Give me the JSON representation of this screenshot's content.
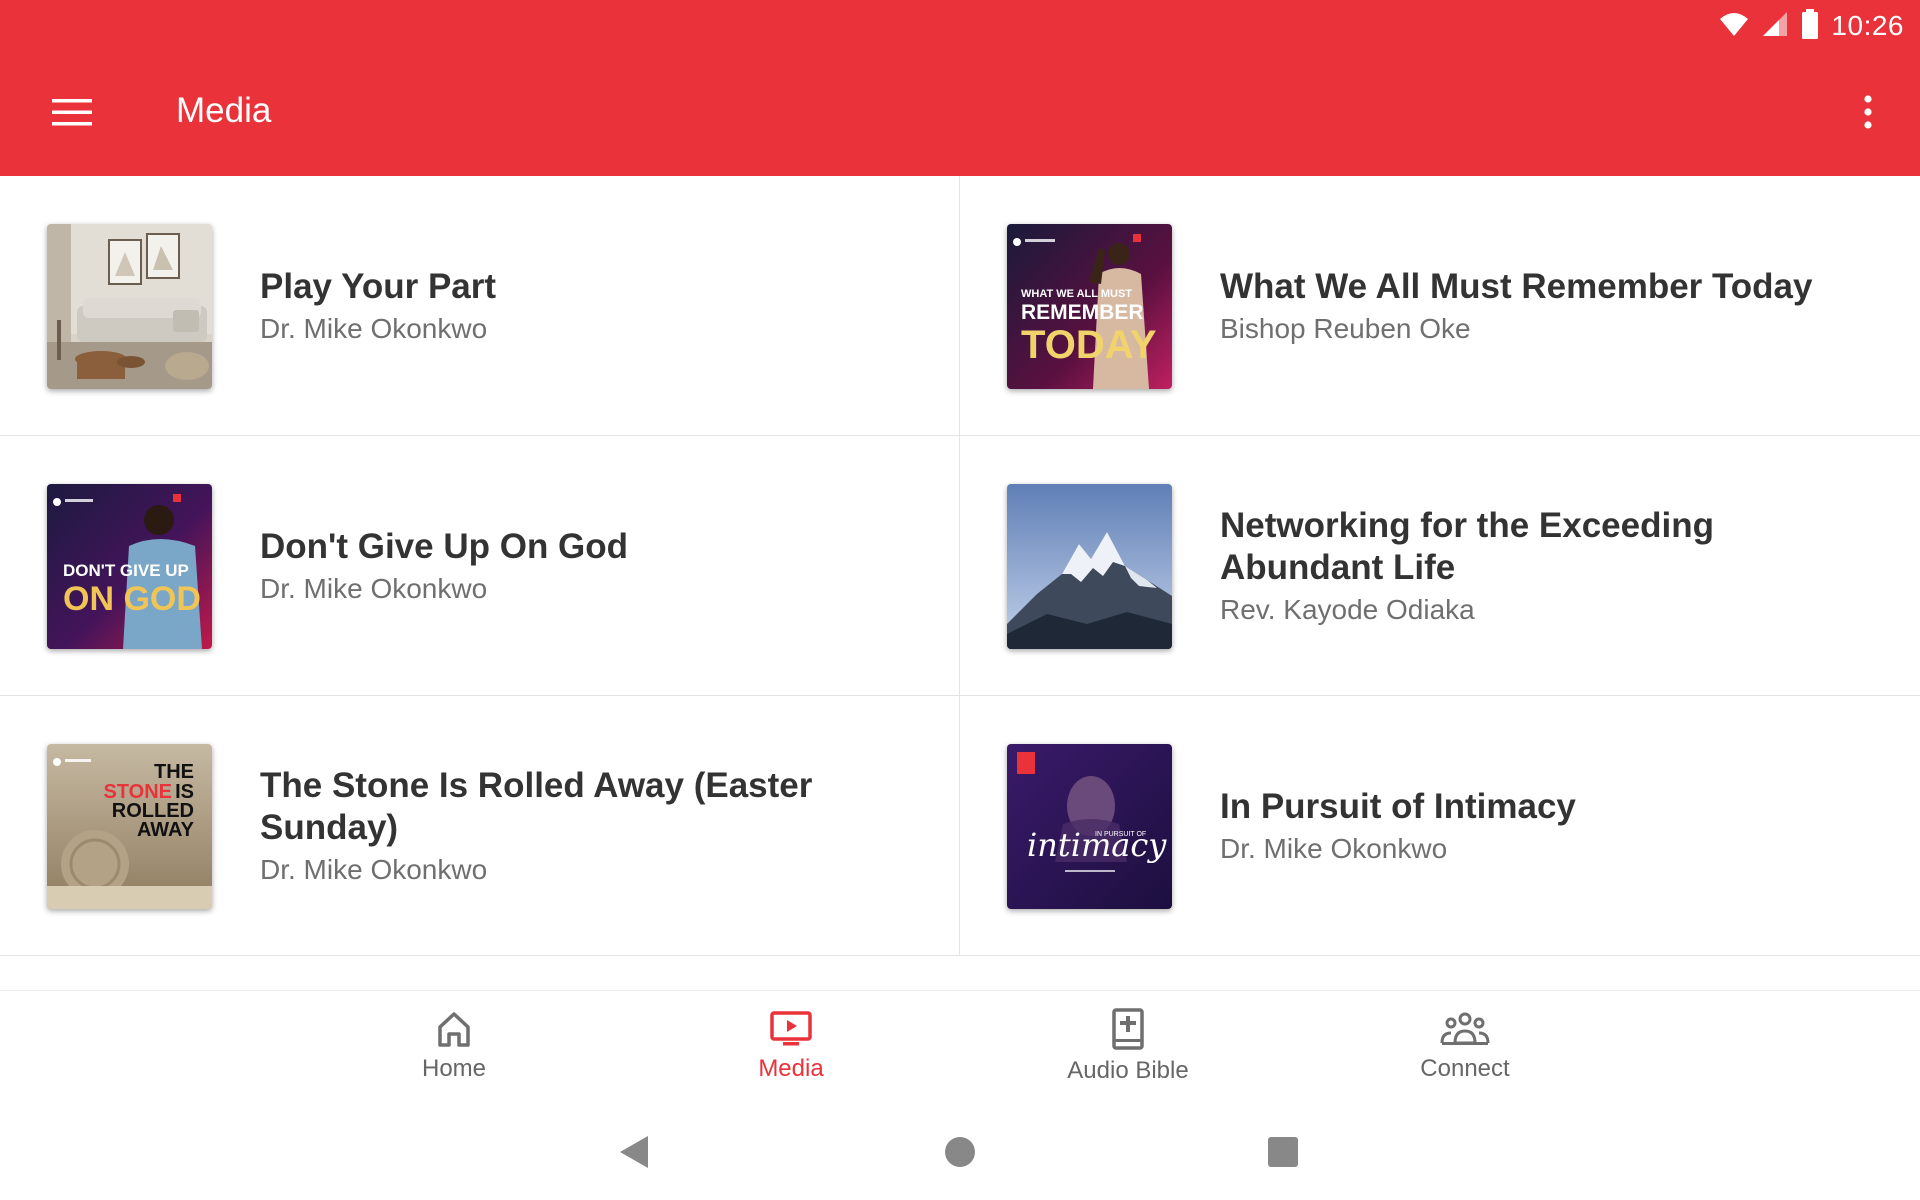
{
  "status_bar": {
    "time": "10:26"
  },
  "app_bar": {
    "title": "Media"
  },
  "media_items": [
    {
      "title": "Play Your Part",
      "author": "Dr. Mike Okonkwo"
    },
    {
      "title": "What We All Must Remember Today",
      "author": "Bishop Reuben Oke"
    },
    {
      "title": "Don't Give Up On God",
      "author": "Dr. Mike Okonkwo"
    },
    {
      "title": "Networking for the Exceeding Abundant Life",
      "author": "Rev. Kayode Odiaka"
    },
    {
      "title": "The Stone Is Rolled Away (Easter Sunday)",
      "author": "Dr. Mike Okonkwo"
    },
    {
      "title": "In Pursuit of Intimacy",
      "author": "Dr. Mike Okonkwo"
    }
  ],
  "thumbnails": {
    "remember": {
      "line1": "WHAT WE ALL MUST",
      "line2": "REMEMBER",
      "line3": "TODAY"
    },
    "dontgiveup": {
      "line1": "DON'T GIVE UP",
      "line2": "ON GOD"
    },
    "stone": {
      "line1": "THE",
      "line2": "STONE",
      "line3": "IS",
      "line4": "ROLLED",
      "line5": "AWAY"
    },
    "intimacy": {
      "small": "IN PURSUIT OF",
      "script": "intimacy"
    }
  },
  "bottom_nav": [
    {
      "label": "Home",
      "icon": "home-icon",
      "active": false
    },
    {
      "label": "Media",
      "icon": "media-icon",
      "active": true
    },
    {
      "label": "Audio Bible",
      "icon": "audio-bible-icon",
      "active": false
    },
    {
      "label": "Connect",
      "icon": "connect-icon",
      "active": false
    }
  ],
  "colors": {
    "primary": "#e9323a",
    "title_text": "#333333",
    "subtitle_text": "#6f6f6f",
    "nav_inactive": "#666666"
  }
}
